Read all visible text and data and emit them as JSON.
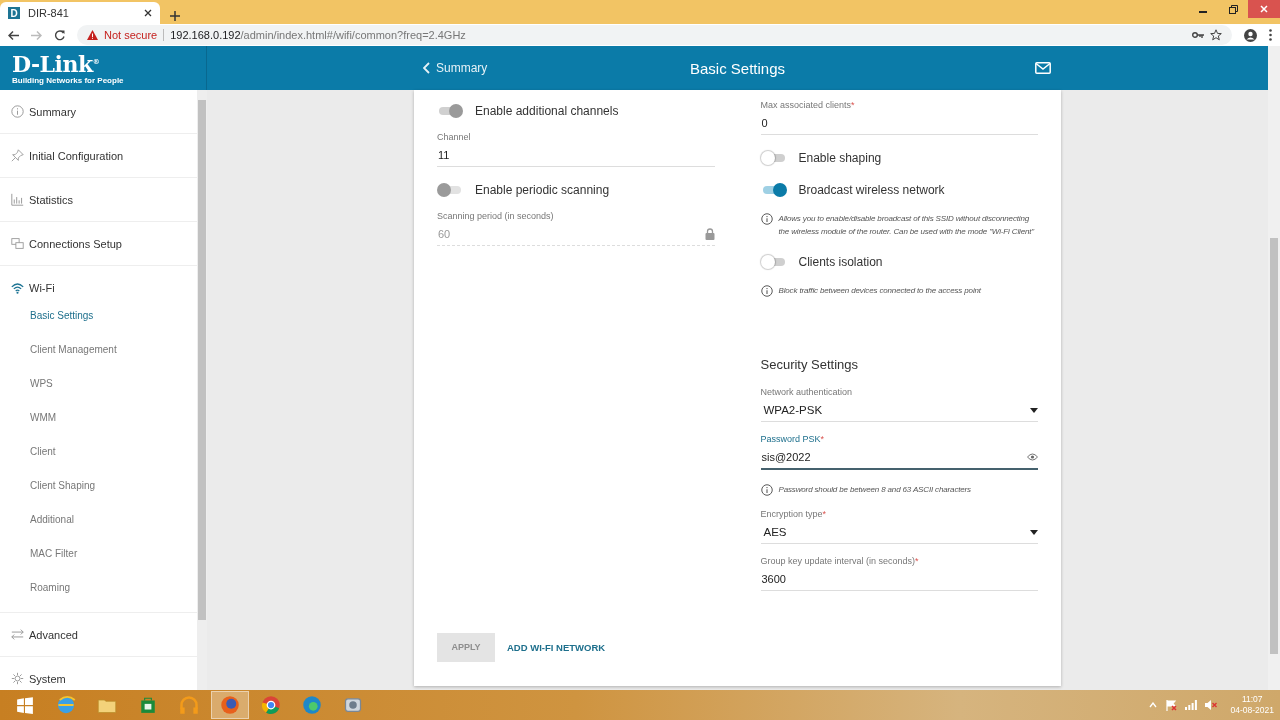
{
  "browser": {
    "tab": {
      "favicon_letter": "D",
      "title": "DIR-841",
      "selected": true
    },
    "security": "Not secure",
    "url_host": "192.168.0.192",
    "url_path": "/admin/index.html#/wifi/common?freq=2.4GHz"
  },
  "header": {
    "logo_name": "D-Link$^{®}$",
    "logo_tagline": "Building Networks for People",
    "back_link": "Summary",
    "title": "Basic Settings"
  },
  "sidebar": {
    "items": [
      {
        "label": "Summary",
        "selected": false
      },
      {
        "label": "Initial Configuration",
        "selected": false
      },
      {
        "label": "Statistics",
        "selected": false
      },
      {
        "label": "Connections Setup",
        "selected": false
      },
      {
        "label": "Wi-Fi",
        "selected": false,
        "children": [
          {
            "label": "Basic Settings",
            "selected": true
          },
          {
            "label": "Client Management",
            "selected": false
          },
          {
            "label": "WPS",
            "selected": false
          },
          {
            "label": "WMM",
            "selected": false
          },
          {
            "label": "Client",
            "selected": false
          },
          {
            "label": "Client Shaping",
            "selected": false
          },
          {
            "label": "Additional",
            "selected": false
          },
          {
            "label": "MAC Filter",
            "selected": false
          },
          {
            "label": "Roaming",
            "selected": false
          }
        ]
      },
      {
        "label": "Advanced",
        "selected": false
      },
      {
        "label": "System",
        "selected": false
      }
    ]
  },
  "content": {
    "left": [
      {
        "kind": "toggle",
        "label": "Enable additional channels",
        "on": true,
        "disabled": true
      },
      {
        "kind": "field",
        "label": "Channel",
        "value": "11",
        "disabled": false,
        "focused": false
      },
      {
        "kind": "toggle",
        "label": "Enable periodic scanning",
        "on": false,
        "disabled": true
      },
      {
        "kind": "field",
        "label": "Scanning period (in seconds)",
        "value": "60",
        "disabled": true,
        "focused": false
      }
    ],
    "right": [
      {
        "kind": "field",
        "label": "Max associated clients",
        "required_mark": "*",
        "value": "0",
        "disabled": false,
        "focused": false
      },
      {
        "kind": "toggle",
        "label": "Enable shaping",
        "on": false,
        "disabled": false
      },
      {
        "kind": "toggle",
        "label": "Broadcast wireless network",
        "on": true,
        "disabled": false
      },
      {
        "kind": "hint",
        "text": "Allows you to enable/disable broadcast of this SSID without disconnecting the wireless module of the router. Can be used with the mode \"Wi-Fi Client\""
      },
      {
        "kind": "toggle",
        "label": "Clients isolation",
        "on": false,
        "disabled": false
      },
      {
        "kind": "hint",
        "text": "Block traffic between devices connected to the access point"
      },
      {
        "kind": "heading",
        "text": "Security Settings"
      },
      {
        "kind": "select",
        "label": "Network authentication",
        "value": "WPA2-PSK",
        "disabled": false,
        "focused": false
      },
      {
        "kind": "password",
        "label": "Password PSK",
        "required_mark": "*",
        "value": "sis@2022",
        "disabled": false,
        "focused": true
      },
      {
        "kind": "hint",
        "text": "Password should be between 8 and 63 ASCII characters"
      },
      {
        "kind": "select",
        "label": "Encryption type",
        "required_mark": "*",
        "value": "AES",
        "disabled": false,
        "focused": false
      },
      {
        "kind": "field",
        "label": "Group key update interval (in seconds)",
        "required_mark": "*",
        "value": "3600",
        "disabled": false,
        "focused": false
      }
    ],
    "buttons": [
      {
        "kind": "primary",
        "label": "APPLY",
        "disabled": true
      },
      {
        "kind": "link",
        "label": "ADD WI-FI NETWORK"
      }
    ]
  },
  "taskbar": {
    "apps": [
      {
        "selected": false
      },
      {
        "selected": false
      },
      {
        "selected": false
      },
      {
        "selected": false
      },
      {
        "selected": false
      },
      {
        "selected": true
      },
      {
        "selected": false
      },
      {
        "selected": false
      },
      {
        "selected": false
      }
    ],
    "time": "11:07",
    "date": "04-08-2021"
  }
}
